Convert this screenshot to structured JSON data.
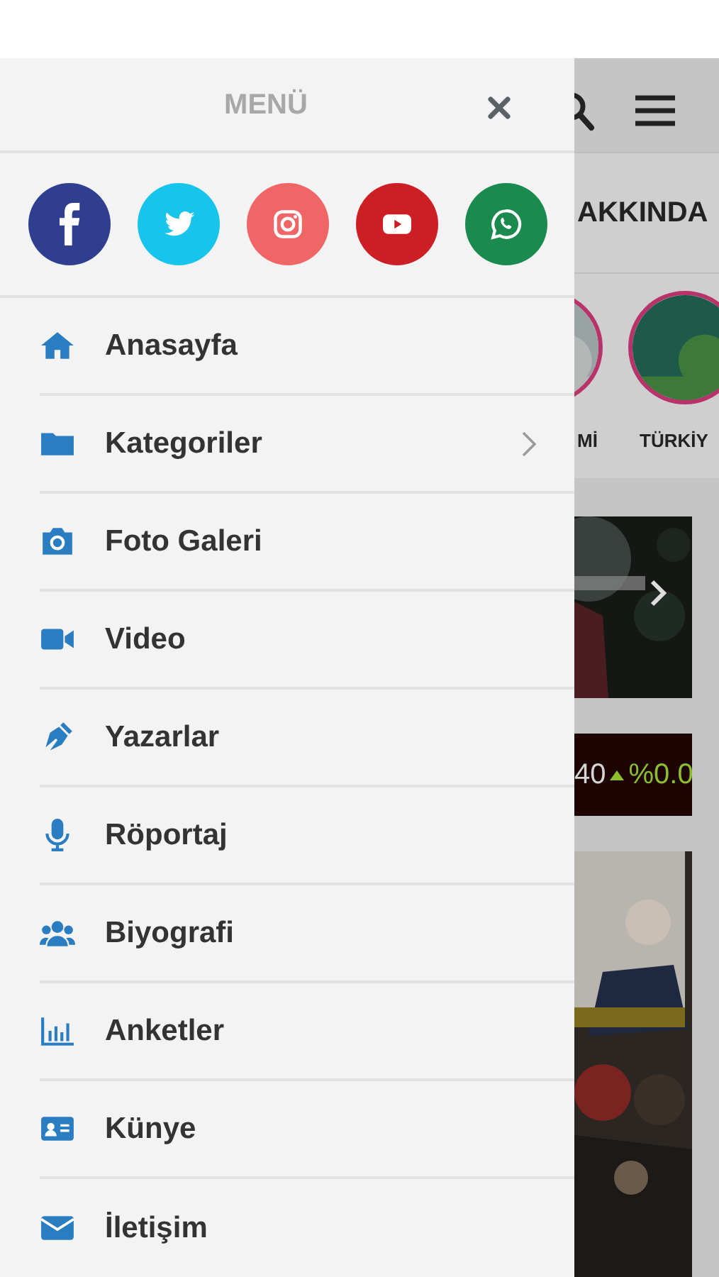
{
  "drawer": {
    "title": "MENÜ",
    "social": [
      {
        "kind": "facebook",
        "color": "#2f3e8f"
      },
      {
        "kind": "twitter",
        "color": "#17c4ec"
      },
      {
        "kind": "instagram",
        "color": "#f06565"
      },
      {
        "kind": "youtube",
        "color": "#cc1f24"
      },
      {
        "kind": "whatsapp",
        "color": "#1b8a4f"
      }
    ],
    "items": [
      {
        "label": "Anasayfa",
        "kind": "home",
        "has_submenu": false
      },
      {
        "label": "Kategoriler",
        "kind": "folder",
        "has_submenu": true
      },
      {
        "label": "Foto Galeri",
        "kind": "camera",
        "has_submenu": false
      },
      {
        "label": "Video",
        "kind": "video",
        "has_submenu": false
      },
      {
        "label": "Yazarlar",
        "kind": "pen",
        "has_submenu": false
      },
      {
        "label": "Röportaj",
        "kind": "mic",
        "has_submenu": false
      },
      {
        "label": "Biyografi",
        "kind": "users",
        "has_submenu": false
      },
      {
        "label": "Anketler",
        "kind": "chart",
        "has_submenu": false
      },
      {
        "label": "Künye",
        "kind": "card",
        "has_submenu": false
      },
      {
        "label": "İletişim",
        "kind": "mail",
        "has_submenu": false
      }
    ]
  },
  "background_page": {
    "nav_label": "AKKINDA",
    "stories": [
      {
        "label": "Mİ"
      },
      {
        "label": "TÜRKİY"
      }
    ],
    "ticker": {
      "value": "40",
      "change": "%0.0"
    }
  }
}
